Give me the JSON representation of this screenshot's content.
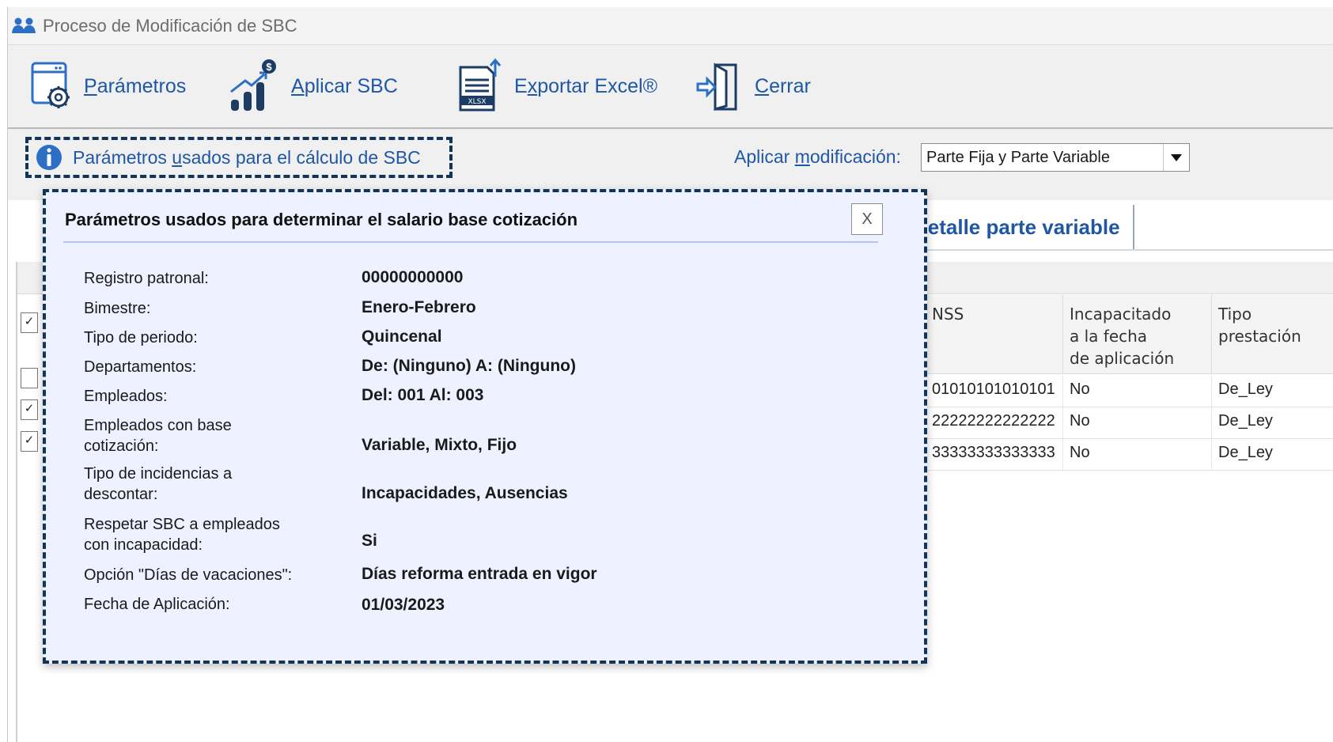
{
  "window": {
    "title": "Proceso de Modificación de SBC"
  },
  "toolbar": {
    "parametros": {
      "first": "P",
      "rest": "arámetros"
    },
    "aplicar": {
      "first": "A",
      "rest": "plicar SBC"
    },
    "exportar": {
      "pre": "E",
      "u": "x",
      "rest": "portar Excel®",
      "badge": "XLSX"
    },
    "cerrar": {
      "first": "C",
      "rest": "errar"
    }
  },
  "options": {
    "info_link": {
      "pre": "Parámetros ",
      "u": "u",
      "rest": "sados para el cálculo de SBC"
    },
    "apply": {
      "pre": "Aplicar ",
      "u": "m",
      "rest": "odificación:",
      "selected": "Parte Fija y Parte Variable"
    }
  },
  "tabs": {
    "variable": "Detalle parte variable"
  },
  "grid": {
    "headers": {
      "nss": "NSS",
      "incap": [
        "Incapacitado",
        "a la fecha",
        "de aplicación"
      ],
      "tipo": [
        "Tipo",
        "prestación"
      ]
    },
    "rows": [
      {
        "nss": "01010101010101",
        "incap": "No",
        "tipo": "De_Ley"
      },
      {
        "nss": "22222222222222",
        "incap": "No",
        "tipo": "De_Ley"
      },
      {
        "nss": "33333333333333",
        "incap": "No",
        "tipo": "De_Ley"
      }
    ]
  },
  "popup": {
    "title": "Parámetros usados para determinar el salario base cotización",
    "close": "X",
    "fields": [
      {
        "label": "Registro patronal:",
        "value": "00000000000"
      },
      {
        "label": "Bimestre:",
        "value": "Enero-Febrero"
      },
      {
        "label": "Tipo de periodo:",
        "value": "Quincenal"
      },
      {
        "label": "Departamentos:",
        "value": "De: (Ninguno) A: (Ninguno)"
      },
      {
        "label": "Empleados:",
        "value": "Del: 001 Al: 003"
      },
      {
        "label_lines": [
          "Empleados con base",
          "cotización:"
        ],
        "value": "Variable, Mixto, Fijo"
      },
      {
        "label_lines": [
          "Tipo de incidencias a",
          "descontar:"
        ],
        "value": "Incapacidades, Ausencias"
      },
      {
        "label_lines": [
          "Respetar SBC a empleados",
          "con incapacidad:"
        ],
        "value": "Si"
      },
      {
        "label": "Opción \"Días de vacaciones\":",
        "value": "Días reforma entrada en vigor"
      },
      {
        "label": "Fecha de Aplicación:",
        "value": "01/03/2023"
      }
    ]
  },
  "colors": {
    "link_blue": "#1f57a5",
    "dashed_border": "#123459",
    "popup_bg": "#eef1ff",
    "icon_blue": "#2c6fc4",
    "icon_dark": "#1d3c63"
  }
}
